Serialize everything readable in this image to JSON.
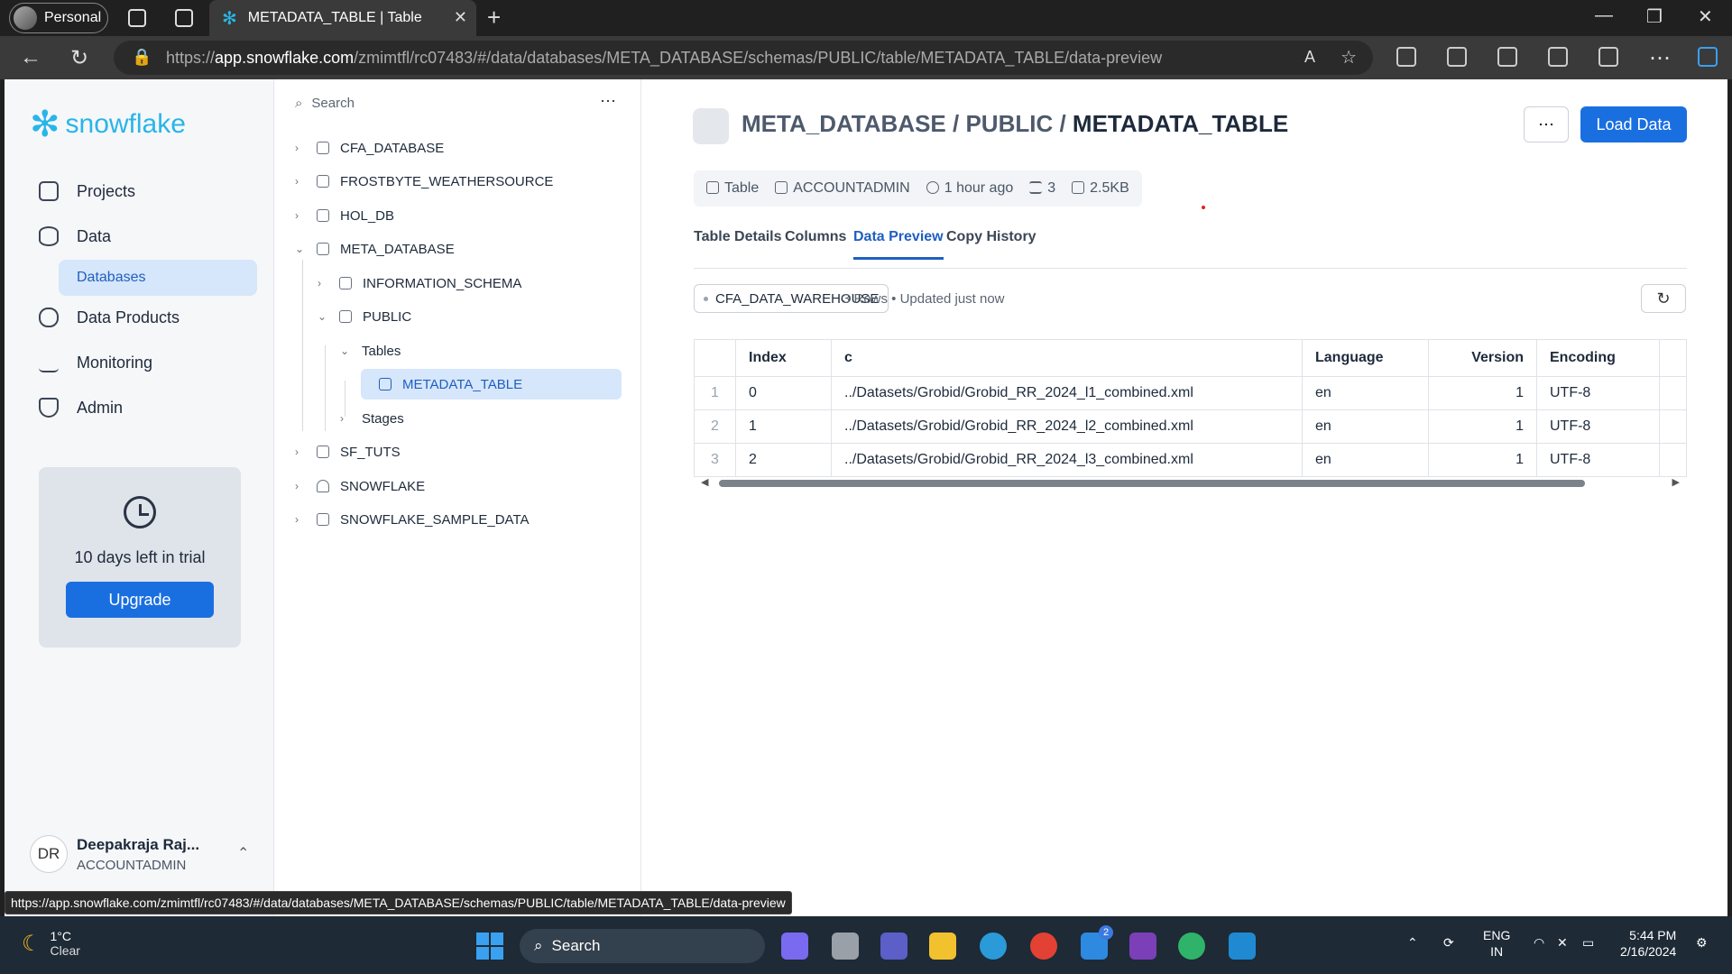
{
  "browser": {
    "profile_label": "Personal",
    "tab_title": "METADATA_TABLE | Table",
    "url_prefix": "https://",
    "url_host": "app.snowflake.com",
    "url_path": "/zmimtfl/rc07483/#/data/databases/META_DATABASE/schemas/PUBLIC/table/METADATA_TABLE/data-preview",
    "status_url": "https://app.snowflake.com/zmimtfl/rc07483/#/data/databases/META_DATABASE/schemas/PUBLIC/table/METADATA_TABLE/data-preview"
  },
  "sidebar": {
    "logo_text": "snowflake",
    "items": [
      {
        "label": "Projects",
        "icon": "projects-icon"
      },
      {
        "label": "Data",
        "icon": "database-icon"
      },
      {
        "label": "Data Products",
        "icon": "cloud-icon"
      },
      {
        "label": "Monitoring",
        "icon": "pulse-icon"
      },
      {
        "label": "Admin",
        "icon": "shield-icon"
      }
    ],
    "sub_active": "Databases",
    "trial_text": "10 days left in trial",
    "upgrade_label": "Upgrade",
    "user_initials": "DR",
    "user_name": "Deepakraja Raj...",
    "user_role": "ACCOUNTADMIN"
  },
  "tree": {
    "search_placeholder": "Search",
    "nodes": [
      {
        "label": "CFA_DATABASE"
      },
      {
        "label": "FROSTBYTE_WEATHERSOURCE"
      },
      {
        "label": "HOL_DB"
      },
      {
        "label": "META_DATABASE"
      },
      {
        "label": "INFORMATION_SCHEMA"
      },
      {
        "label": "PUBLIC"
      },
      {
        "label": "Tables"
      },
      {
        "label": "METADATA_TABLE"
      },
      {
        "label": "Stages"
      },
      {
        "label": "SF_TUTS"
      },
      {
        "label": "SNOWFLAKE"
      },
      {
        "label": "SNOWFLAKE_SAMPLE_DATA"
      }
    ]
  },
  "main": {
    "breadcrumb_db": "META_DATABASE",
    "breadcrumb_sep": " / ",
    "breadcrumb_schema": "PUBLIC",
    "breadcrumb_table": "METADATA_TABLE",
    "load_label": "Load Data",
    "meta": {
      "type": "Table",
      "owner": "ACCOUNTADMIN",
      "time": "1 hour ago",
      "columns": "3",
      "size": "2.5KB"
    },
    "tabs": [
      "Table Details",
      "Columns",
      "Data Preview",
      "Copy History"
    ],
    "warehouse": "CFA_DATA_WAREHOUSE",
    "row_info": "3 Rows • Updated just now",
    "table": {
      "headers": [
        "Index",
        "c",
        "Language",
        "Version",
        "Encoding"
      ],
      "rows": [
        [
          "1",
          "0",
          "../Datasets/Grobid/Grobid_RR_2024_l1_combined.xml",
          "en",
          "1",
          "UTF-8"
        ],
        [
          "2",
          "1",
          "../Datasets/Grobid/Grobid_RR_2024_l2_combined.xml",
          "en",
          "1",
          "UTF-8"
        ],
        [
          "3",
          "2",
          "../Datasets/Grobid/Grobid_RR_2024_l3_combined.xml",
          "en",
          "1",
          "UTF-8"
        ]
      ]
    }
  },
  "taskbar": {
    "temp": "1°C",
    "weather": "Clear",
    "search_label": "Search",
    "lang": "ENG",
    "region": "IN",
    "time": "5:44 PM",
    "date": "2/16/2024",
    "badge": "2"
  }
}
